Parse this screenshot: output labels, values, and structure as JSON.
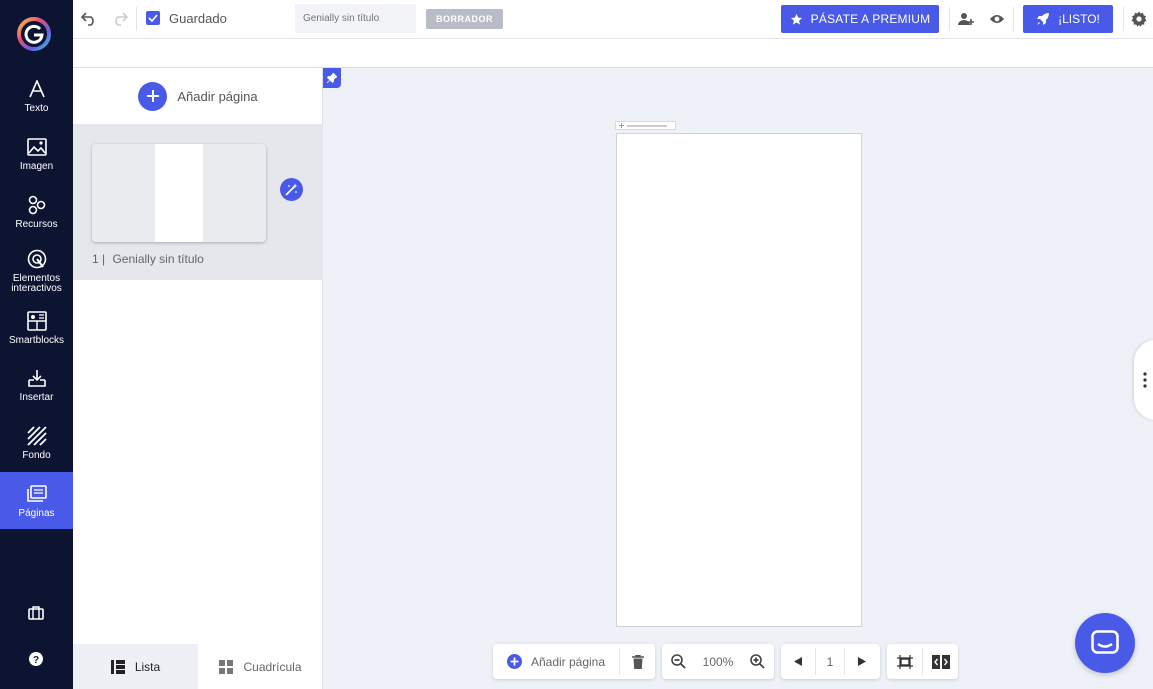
{
  "toolbar": {
    "saved_label": "Guardado",
    "title_placeholder": "Genially sin título",
    "draft_badge": "BORRADOR",
    "premium_label": "PÁSATE A PREMIUM",
    "ready_label": "¡LISTO!"
  },
  "sidebar": {
    "items": [
      {
        "label": "Texto",
        "icon": "text-icon"
      },
      {
        "label": "Imagen",
        "icon": "image-icon"
      },
      {
        "label": "Recursos",
        "icon": "resources-icon"
      },
      {
        "label": "Elementos interactivos",
        "icon": "interactive-icon"
      },
      {
        "label": "Smartblocks",
        "icon": "smartblocks-icon"
      },
      {
        "label": "Insertar",
        "icon": "insert-icon"
      },
      {
        "label": "Fondo",
        "icon": "background-icon"
      },
      {
        "label": "Páginas",
        "icon": "pages-icon",
        "active": true
      }
    ]
  },
  "pages_panel": {
    "add_page_label": "Añadir página",
    "pages": [
      {
        "number": "1 |",
        "title": "Genially sin título"
      }
    ],
    "tabs": [
      {
        "label": "Lista",
        "active": true
      },
      {
        "label": "Cuadrícula",
        "active": false
      }
    ]
  },
  "bottom_toolbar": {
    "add_page_label": "Añadir página",
    "zoom": "100%",
    "current_page": "1"
  },
  "colors": {
    "accent": "#4a5ae8",
    "sidebar_bg": "#0d1432",
    "canvas_bg": "#eef2f8"
  }
}
